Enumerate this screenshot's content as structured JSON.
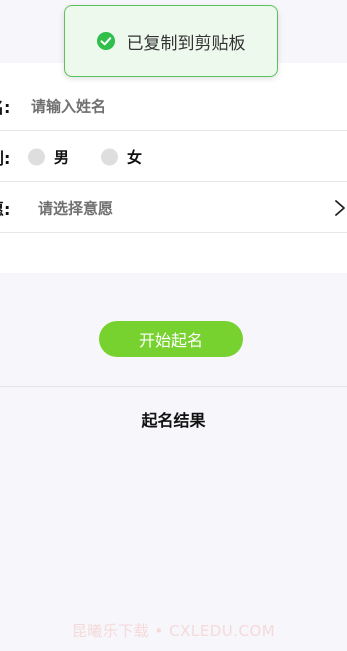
{
  "toast": {
    "message": "已复制到剪贴板",
    "icon": "check-circle-icon",
    "color": "#2fbf4a"
  },
  "form": {
    "name": {
      "label": "名:",
      "placeholder": "请输入姓名"
    },
    "gender": {
      "label": "别:",
      "options": [
        "男",
        "女"
      ]
    },
    "wish": {
      "label": "愿:",
      "placeholder": "请选择意愿",
      "icon": "chevron-right-icon"
    }
  },
  "actions": {
    "start_label": "开始起名",
    "accent": "#77d22f"
  },
  "result": {
    "title": "起名结果"
  },
  "watermark": {
    "text": "昆曦乐下载 • CXLEDU.COM"
  }
}
